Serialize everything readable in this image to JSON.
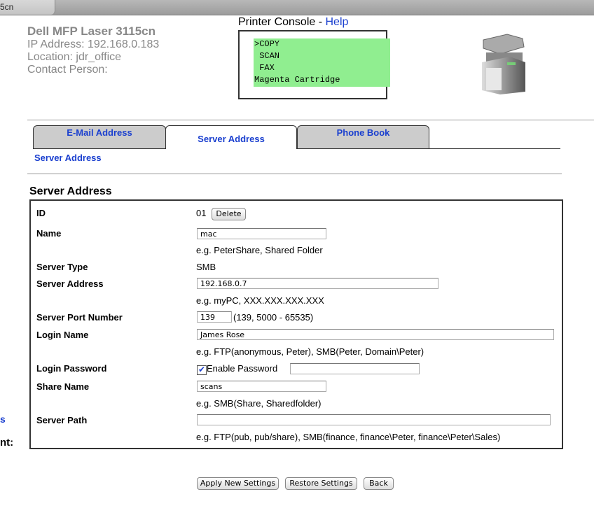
{
  "browser": {
    "tab_label": "5cn"
  },
  "device": {
    "title": "Dell MFP Laser 3115cn",
    "ip": "IP Address: 192.168.0.183",
    "location": "Location: jdr_office",
    "contact": "Contact Person:"
  },
  "console": {
    "title": "Printer Console - ",
    "help": "Help",
    "lcd_lines": [
      ">COPY",
      " SCAN",
      " FAX",
      "Magenta Cartridge"
    ],
    "lcd_color": "#90ee90"
  },
  "tabs": [
    {
      "label": "E-Mail Address"
    },
    {
      "label": "Server Address",
      "active": true
    },
    {
      "label": "Phone Book"
    }
  ],
  "subnav": "Server Address",
  "section_title": "Server Address",
  "form": {
    "id_label": "ID",
    "id_value": "01",
    "delete": "Delete",
    "name_label": "Name",
    "name_value": "mac",
    "name_hint": "e.g. PeterShare, Shared Folder",
    "type_label": "Server Type",
    "type_value": "SMB",
    "addr_label": "Server Address",
    "addr_value": "192.168.0.7",
    "addr_hint": "e.g. myPC, XXX.XXX.XXX.XXX",
    "port_label": "Server Port Number",
    "port_value": "139",
    "port_hint": "(139, 5000 - 65535)",
    "login_label": "Login Name",
    "login_value": "James Rose",
    "login_hint": "e.g. FTP(anonymous, Peter), SMB(Peter, Domain\\Peter)",
    "pw_label": "Login Password",
    "pw_checkbox": "Enable Password",
    "pw_checked": true,
    "pw_value": "",
    "share_label": "Share Name",
    "share_value": "scans",
    "share_hint": "e.g. SMB(Share, Sharedfolder)",
    "path_label": "Server Path",
    "path_value": "",
    "path_hint": "e.g. FTP(pub, pub/share), SMB(finance, finance\\Peter, finance\\Peter\\Sales)"
  },
  "buttons": {
    "apply": "Apply New Settings",
    "restore": "Restore Settings",
    "back": "Back"
  },
  "left_fragments": {
    "link": "s",
    "label": "nt:"
  },
  "accent": "#1a3fcf"
}
